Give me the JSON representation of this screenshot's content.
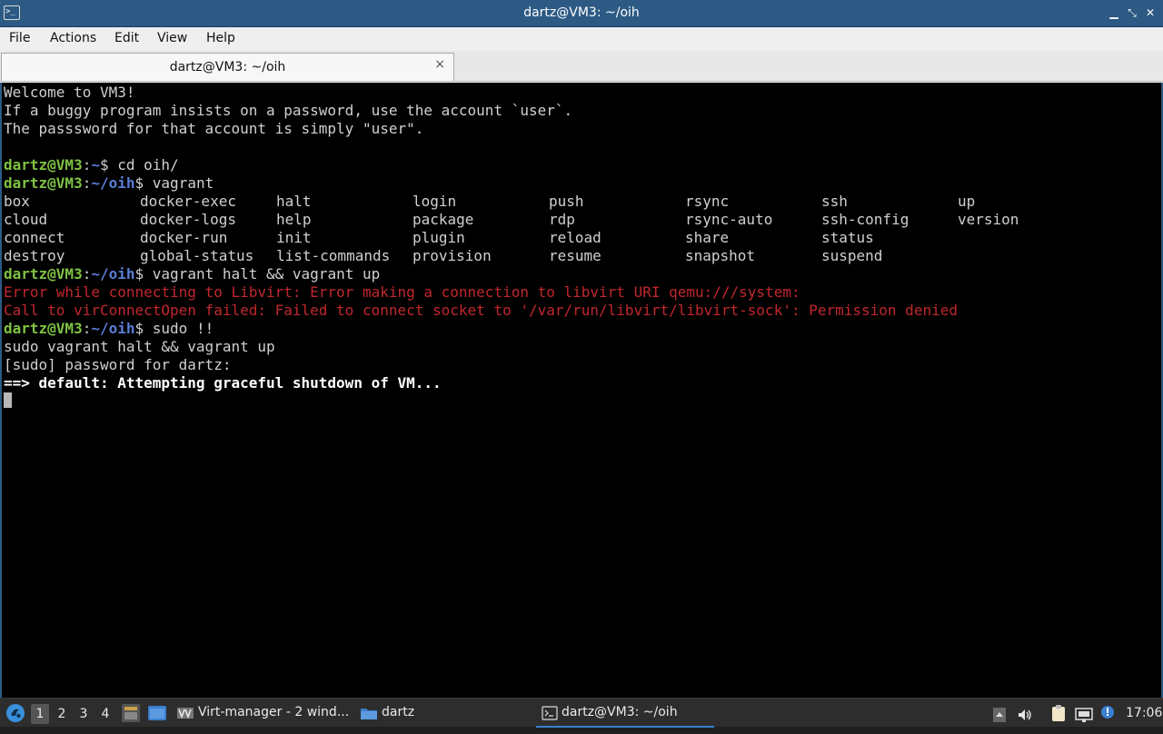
{
  "window": {
    "title": "dartz@VM3: ~/oih",
    "app_icon_glyph": ">_",
    "min_glyph": "▁",
    "max_glyph": "⤡",
    "close_glyph": "✕"
  },
  "menu": [
    "File",
    "Actions",
    "Edit",
    "View",
    "Help"
  ],
  "tab": {
    "label": "dartz@VM3: ~/oih",
    "close_glyph": "×"
  },
  "terminal": {
    "welcome": [
      "Welcome to VM3!",
      "If a buggy program insists on a password, use the account `user`.",
      "The passsword for that account is simply \"user\"."
    ],
    "prompt_user": "dartz@VM3",
    "prompt_colon": ":",
    "path_home": "~",
    "path_oih": "~/oih",
    "dollar": "$ ",
    "cmd1": "cd oih/",
    "cmd2": "vagrant",
    "vagrant_commands": [
      [
        "box",
        "docker-exec",
        "halt",
        "login",
        "push",
        "rsync",
        "ssh",
        "up"
      ],
      [
        "cloud",
        "docker-logs",
        "help",
        "package",
        "rdp",
        "rsync-auto",
        "ssh-config",
        "version"
      ],
      [
        "connect",
        "docker-run",
        "init",
        "plugin",
        "reload",
        "share",
        "status",
        ""
      ],
      [
        "destroy",
        "global-status",
        "list-commands",
        "provision",
        "resume",
        "snapshot",
        "suspend",
        ""
      ]
    ],
    "cmd3": "vagrant halt && vagrant up",
    "error1": "Error while connecting to Libvirt: Error making a connection to libvirt URI qemu:///system:",
    "error2": "Call to virConnectOpen failed: Failed to connect socket to '/var/run/libvirt/libvirt-sock': Permission denied",
    "cmd4": "sudo !!",
    "echo": "sudo vagrant halt && vagrant up",
    "sudo_prompt": "[sudo] password for dartz:",
    "status": "==> default: Attempting graceful shutdown of VM..."
  },
  "taskbar": {
    "desktops": [
      "1",
      "2",
      "3",
      "4"
    ],
    "tasks": [
      {
        "label": "Virt-manager - 2 wind..."
      },
      {
        "label": "dartz"
      },
      {
        "label": "dartz@VM3: ~/oih"
      }
    ],
    "clock": "17:06"
  }
}
